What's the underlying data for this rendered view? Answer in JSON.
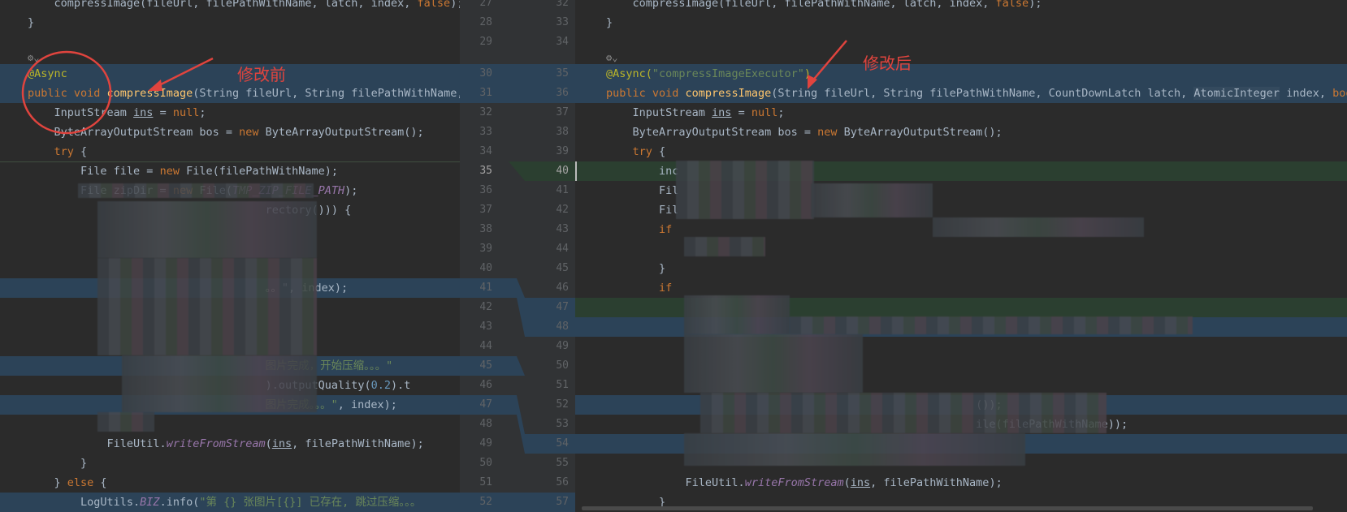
{
  "left": {
    "lines": [
      {
        "text": "        compressImage(fileUrl, filePathWithName, latch, index, false);"
      },
      {
        "text": "    }"
      },
      {
        "text": ""
      },
      {
        "text": ""
      },
      {
        "text": "    @Async"
      },
      {
        "text": "    public void compressImage(String fileUrl, String filePathWithName,"
      },
      {
        "text": "        InputStream ins = null;"
      },
      {
        "text": "        ByteArrayOutputStream bos = new ByteArrayOutputStream();"
      },
      {
        "text": "        try {"
      },
      {
        "text": "            File file = new File(filePathWithName);"
      },
      {
        "text": "            File zipDir = new File(TMP_ZIP_FILE_PATH);"
      },
      {
        "text": "                                        rectory())) {"
      },
      {
        "text": ""
      },
      {
        "text": ""
      },
      {
        "text": ""
      },
      {
        "text": "                                        。。\", index);"
      },
      {
        "text": ""
      },
      {
        "text": ""
      },
      {
        "text": ""
      },
      {
        "text": "                                        图片完成，开始压缩。。。\""
      },
      {
        "text": "                                        ).outputQuality(0.2).t"
      },
      {
        "text": "                                        图片完成。。。\", index);"
      },
      {
        "text": ""
      },
      {
        "text": "                FileUtil.writeFromStream(ins, filePathWithName);"
      },
      {
        "text": "            }"
      },
      {
        "text": "        } else {"
      },
      {
        "text": "            LogUtils.BIZ.info(\"第 {} 张图片[{}] 已存在, 跳过压缩。。。"
      }
    ]
  },
  "gutter": {
    "left_numbers": [
      "27",
      "28",
      "29",
      "",
      "30",
      "31",
      "32",
      "33",
      "34",
      "35",
      "36",
      "37",
      "38",
      "39",
      "40",
      "41",
      "42",
      "43",
      "44",
      "45",
      "46",
      "47",
      "48",
      "49",
      "50",
      "51",
      "52"
    ],
    "right_numbers": [
      "32",
      "33",
      "34",
      "",
      "35",
      "36",
      "37",
      "38",
      "39",
      "40",
      "41",
      "42",
      "43",
      "44",
      "45",
      "46",
      "47",
      "48",
      "49",
      "50",
      "51",
      "52",
      "53",
      "54",
      "55",
      "56",
      "57"
    ]
  },
  "right": {
    "lines": [
      {
        "text": "        compressImage(fileUrl, filePathWithName, latch, index, false);"
      },
      {
        "text": "    }"
      },
      {
        "text": ""
      },
      {
        "text": ""
      },
      {
        "text": "    @Async(\"compressImageExecutor\")"
      },
      {
        "text": "    public void compressImage(String fileUrl, String filePathWithName, CountDownLatch latch, AtomicInteger index, bool"
      },
      {
        "text": "        InputStream ins = null;"
      },
      {
        "text": "        ByteArrayOutputStream bos = new ByteArrayOutputStream();"
      },
      {
        "text": "        try {"
      },
      {
        "text": "            inc"
      },
      {
        "text": "            Fil"
      },
      {
        "text": "            Fil"
      },
      {
        "text": "            if"
      },
      {
        "text": ""
      },
      {
        "text": "            }"
      },
      {
        "text": "            if"
      },
      {
        "text": ""
      },
      {
        "text": ""
      },
      {
        "text": ""
      },
      {
        "text": ""
      },
      {
        "text": ""
      },
      {
        "text": "                                                                   ());"
      },
      {
        "text": "                                                                   ile(filePathWithName));"
      },
      {
        "text": ""
      },
      {
        "text": ""
      },
      {
        "text": "                FileUtil.writeFromStream(ins, filePathWithName);"
      },
      {
        "text": "            }"
      }
    ]
  },
  "annotations": {
    "before": "修改前",
    "after": "修改后"
  },
  "colors": {
    "annotation_red": "#e0443e",
    "changed_bg": "#2c4358",
    "inserted_bg": "#2b3f30"
  },
  "icons": [
    "gutter-settings-icon",
    "arrow-icon"
  ]
}
